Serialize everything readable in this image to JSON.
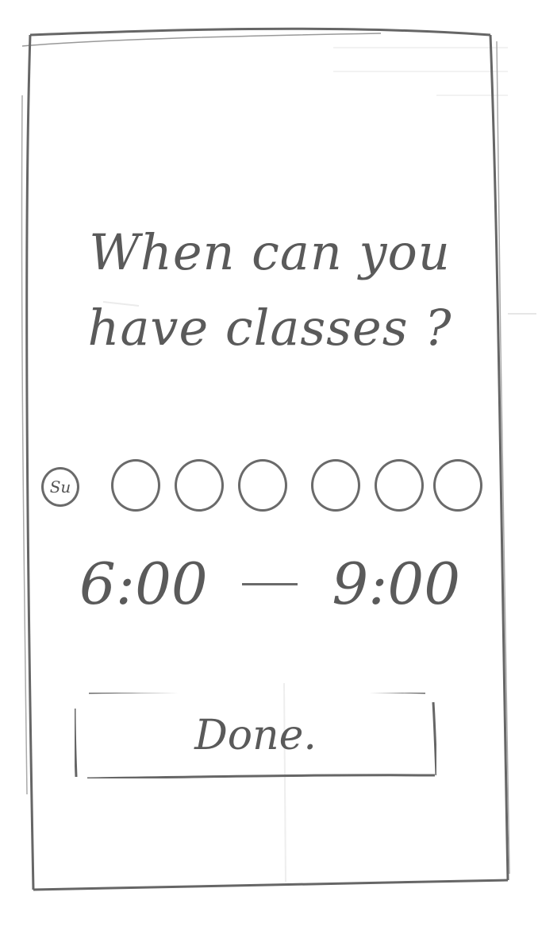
{
  "screen": {
    "question": "When can you have classes ?"
  },
  "day_picker": {
    "days": [
      {
        "label": "Su",
        "selected": false
      },
      {
        "label": "",
        "selected": false
      },
      {
        "label": "",
        "selected": false
      },
      {
        "label": "",
        "selected": false
      },
      {
        "label": "",
        "selected": false
      },
      {
        "label": "",
        "selected": false
      },
      {
        "label": "",
        "selected": false
      }
    ]
  },
  "time_range": {
    "start": "6:00",
    "end": "9:00"
  },
  "actions": {
    "done_label": "Done."
  }
}
